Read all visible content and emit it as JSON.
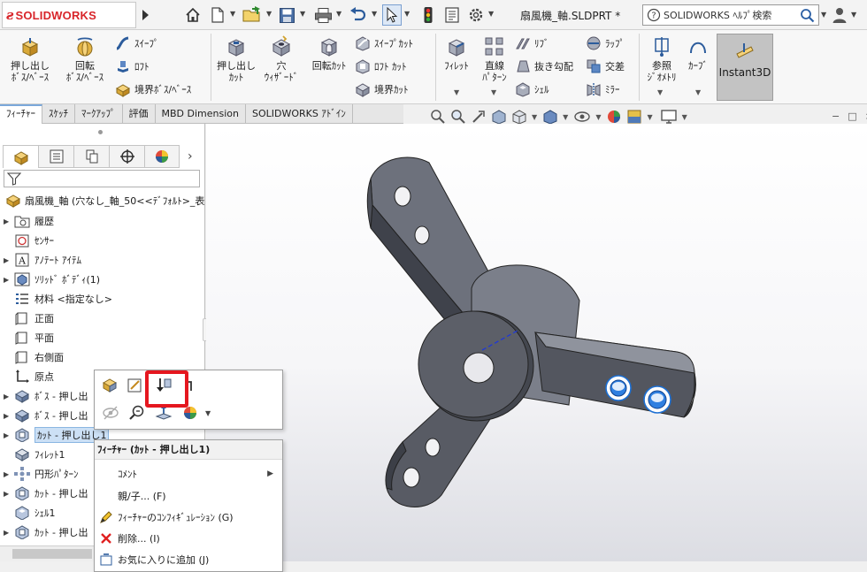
{
  "app": {
    "logo_text": "SOLIDWORKS",
    "doc_title": "扇風機_軸.SLDPRT *",
    "help_search_placeholder": "SOLIDWORKS ﾍﾙﾌﾟ検索"
  },
  "ribbon": {
    "extrude_boss": "押し出し\nﾎﾞｽ/ﾍﾞｰｽ",
    "revolve_boss": "回転\nﾎﾞｽ/ﾍﾞｰｽ",
    "sweep": "ｽｲｰﾌﾟ",
    "loft": "ﾛﾌﾄ",
    "boundary_boss": "境界ﾎﾞｽ/ﾍﾞｰｽ",
    "extrude_cut": "押し出し\nｶｯﾄ",
    "hole_wizard": "穴\nｳｨｻﾞｰﾄﾞ",
    "revolve_cut": "回転ｶｯﾄ",
    "sweep_cut": "ｽｲｰﾌﾟｶｯﾄ",
    "loft_cut": "ﾛﾌﾄ ｶｯﾄ",
    "boundary_cut": "境界ｶｯﾄ",
    "fillet": "ﾌｨﾚｯﾄ",
    "linear_pattern": "直線\nﾊﾟﾀｰﾝ",
    "rib": "ﾘﾌﾞ",
    "draft": "抜き勾配",
    "shell": "ｼｪﾙ",
    "wrap": "ﾗｯﾌﾟ",
    "intersect": "交差",
    "mirror": "ﾐﾗｰ",
    "ref_geometry": "参照\nｼﾞｵﾒﾄﾘ",
    "curves": "ｶｰﾌﾞ",
    "instant3d": "Instant3D"
  },
  "tabs": [
    "ﾌｨｰﾁｬｰ",
    "ｽｹｯﾁ",
    "ﾏｰｸｱｯﾌﾟ",
    "評価",
    "MBD Dimension",
    "SOLIDWORKS ｱﾄﾞｲﾝ"
  ],
  "tree": {
    "root": "扇風機_軸 (穴なし_軸_50<<ﾃﾞﾌｫﾙﾄ>_表",
    "items": [
      {
        "label": "履歴",
        "arrow": "▶"
      },
      {
        "label": "ｾﾝｻｰ",
        "arrow": ""
      },
      {
        "label": "ｱﾉﾃｰﾄ ｱｲﾃﾑ",
        "arrow": "▶"
      },
      {
        "label": "ｿﾘｯﾄﾞ ﾎﾞﾃﾞｨ(1)",
        "arrow": "▶"
      },
      {
        "label": "材料 <指定なし>",
        "arrow": ""
      },
      {
        "label": "正面",
        "arrow": ""
      },
      {
        "label": "平面",
        "arrow": ""
      },
      {
        "label": "右側面",
        "arrow": ""
      },
      {
        "label": "原点",
        "arrow": ""
      },
      {
        "label": "ﾎﾞｽ - 押し出",
        "arrow": "▶"
      },
      {
        "label": "ﾎﾞｽ - 押し出",
        "arrow": "▶"
      },
      {
        "label": "ｶｯﾄ - 押し出し1",
        "arrow": "▶"
      },
      {
        "label": "ﾌｨﾚｯﾄ1",
        "arrow": ""
      },
      {
        "label": "円形ﾊﾟﾀｰﾝ",
        "arrow": "▶"
      },
      {
        "label": "ｶｯﾄ - 押し出",
        "arrow": "▶"
      },
      {
        "label": "ｼｪﾙ1",
        "arrow": ""
      },
      {
        "label": "ｶｯﾄ - 押し出",
        "arrow": "▶"
      }
    ]
  },
  "context_menu": {
    "header": "ﾌｨｰﾁｬｰ (ｶｯﾄ - 押し出し1)",
    "items": [
      {
        "label": "ｺﾒﾝﾄ",
        "submenu": "▶"
      },
      {
        "label": "親/子... (F)"
      },
      {
        "label": "ﾌｨｰﾁｬｰのｺﾝﾌｨｷﾞｭﾚｰｼｮﾝ (G)"
      },
      {
        "label": "削除... (I)"
      },
      {
        "label": "お気に入りに追加 (J)"
      }
    ]
  },
  "colors": {
    "accent_red": "#e5171f",
    "brand_red": "#d8252a",
    "selection_blue": "#cce0f5",
    "model_face": "#4a4d57"
  }
}
